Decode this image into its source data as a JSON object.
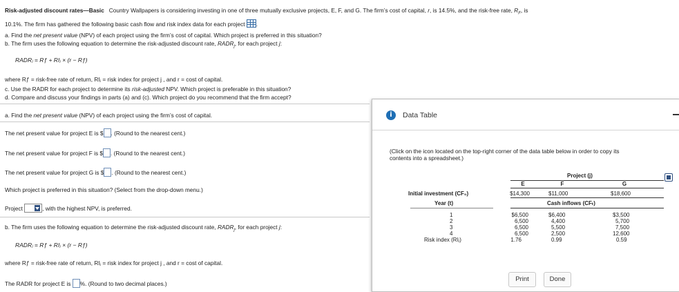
{
  "problem": {
    "title": "Risk-adjusted discount rates—Basic",
    "intro1": "Country Wallpapers is considering investing in one of three mutually exclusive projects, E, F, and G. The firm’s cost of capital,",
    "r": "r",
    "intro2": ", is 14.5%, and the risk-free rate,",
    "rf": "R",
    "rf_sub": "F",
    "intro3": ", is",
    "intro4": "10.1%. The firm has gathered the following basic cash flow and risk index data for each project",
    "qa_pre": "a. Find the",
    "qa_it": "net present value",
    "qa_post": "(NPV) of each project using the firm’s cost of capital.  Which project is preferred in this situation?",
    "qb_pre": "b. The firm uses the following equation to determine the risk-adjusted discount rate,",
    "qb_radr": "RADR",
    "qb_sub": "j",
    "qb_post": ", for each project",
    "qb_j": "j",
    "qb_colon": ":",
    "formula": "RADRⱼ = Rƒ + RIⱼ × (r − Rƒ)",
    "where": "where Rƒ = risk-free rate of return, RIⱼ = risk index for project  j , and r  = cost of capital.",
    "qc_pre": "c. Use the RADR for each project to determine its",
    "qc_it": "risk-adjusted",
    "qc_post": "NPV.  Which project is preferable in this situation?",
    "qd": "d. Compare and discuss your findings in parts (a) and (c).  Which project do you recommend that the firm accept?"
  },
  "answers": {
    "a_header_pre": "a. Find the",
    "a_header_it": "net present value",
    "a_header_post": "(NPV) of each project using the firm’s cost of capital.",
    "npv_e": "The net present value for project E is $",
    "npv_f": "The net present value for project F is $",
    "npv_g": "The net present value for project G is $",
    "round_cent": ".  (Round to the nearest cent.)",
    "which": "Which project is preferred in this situation?  (Select from the drop-down menu.)",
    "project_label": "Project",
    "highest": ", with the highest NPV, is preferred.",
    "b_header_pre": "b. The firm uses the following equation to determine the risk-adjusted discount rate,",
    "b_radr": "RADR",
    "b_sub": "j",
    "b_post": ", for each project",
    "b_j": "j",
    "b_colon": ":",
    "formula": "RADRⱼ = Rƒ + RIⱼ × (r − Rƒ)",
    "where": "where Rƒ = risk-free rate of return, RIⱼ = risk index for project  j , and r  = cost of capital.",
    "radr_e": "The RADR for project E is",
    "round_two": "%.  (Round to two decimal places.)"
  },
  "modal": {
    "title": "Data Table",
    "instructions_1": "(Click on the icon located on the top-right corner of the data table below in order to copy its",
    "instructions_2": "contents into a spreadsheet.)",
    "project_header": "Project (j)",
    "columns": [
      "E",
      "F",
      "G"
    ],
    "initial_label": "Initial investment (CF₀)",
    "initial": [
      "$14,300",
      "$11,000",
      "$18,600"
    ],
    "year_label": "Year (t)",
    "cash_label": "Cash inflows (CFₜ)",
    "rows": [
      {
        "year": "1",
        "e": "$6,500",
        "f": "$6,400",
        "g": "$3,500"
      },
      {
        "year": "2",
        "e": "6,500",
        "f": "4,400",
        "g": "5,700"
      },
      {
        "year": "3",
        "e": "6,500",
        "f": "5,500",
        "g": "7,500"
      },
      {
        "year": "4",
        "e": "6,500",
        "f": "2,500",
        "g": "12,600"
      }
    ],
    "risk_label": "Risk index (RIⱼ)",
    "risk": [
      "1.76",
      "0.99",
      "0.59"
    ],
    "print": "Print",
    "done": "Done",
    "info_glyph": "i"
  }
}
